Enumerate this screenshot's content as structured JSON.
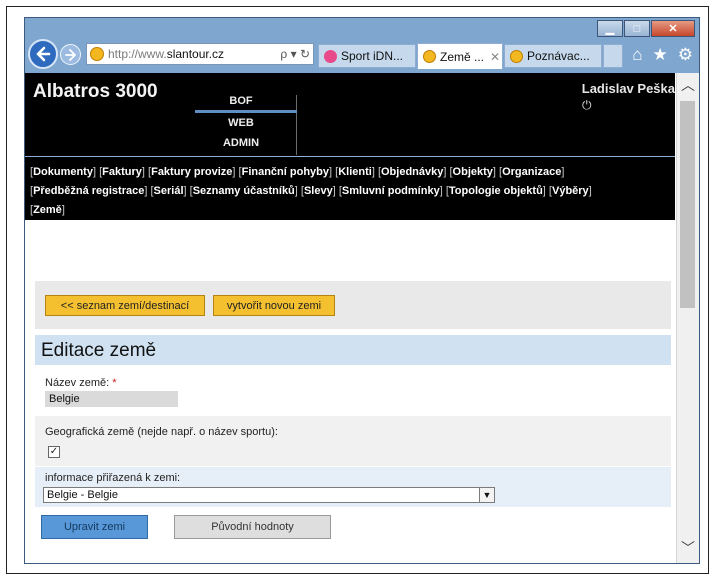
{
  "window": {
    "controls": {
      "minimize": "▁",
      "maximize": "□",
      "close": "✕"
    }
  },
  "navbar": {
    "address": {
      "prefix": "http://www.",
      "domain": "slantour.cz",
      "tools": "ρ ▾ ↻"
    },
    "tabs": [
      {
        "label": "Sport iDN...",
        "icon_color": "#e84a8a",
        "close": ""
      },
      {
        "label": "Země ...",
        "icon_color": "#f3b81f",
        "close": "✕"
      },
      {
        "label": "Poznávac...",
        "icon_color": "#f3b81f",
        "close": ""
      }
    ],
    "home_icon": "⌂",
    "star_icon": "★",
    "gear_icon": "⚙"
  },
  "app": {
    "title": "Albatros 3000",
    "user": "Ladislav Peška",
    "power_icon": "⏻",
    "modules": [
      "BOF",
      "WEB",
      "ADMIN"
    ],
    "active_module": "WEB",
    "menu": [
      "Dokumenty",
      "Faktury",
      "Faktury provize",
      "Finanční pohyby",
      "Klienti",
      "Objednávky",
      "Objekty",
      "Organizace",
      "Předběžná registrace",
      "Seriál",
      "Seznamy účastníků",
      "Slevy",
      "Smluvní podmínky",
      "Topologie objektů",
      "Výběry",
      "Země"
    ]
  },
  "toolbar": {
    "back_list": "<< seznam zemí/destinací",
    "create_new": "vytvořit novou zemi"
  },
  "form": {
    "heading": "Editace země",
    "name_label": "Název země:",
    "required_mark": "*",
    "name_value": "Belgie",
    "geo_label": "Geografická země (nejde např. o název sportu):",
    "geo_checked": "✓",
    "info_label": "informace přiřazená k zemi:",
    "info_selected": "Belgie - Belgie",
    "info_arrow": "▼",
    "submit": "Upravit zemi",
    "reset": "Původní hodnoty"
  },
  "colors": {
    "accent_blue": "#5898d8",
    "yellow_button": "#f4c030",
    "header_bg": "#000000",
    "section_bg": "#d0e2f2"
  }
}
